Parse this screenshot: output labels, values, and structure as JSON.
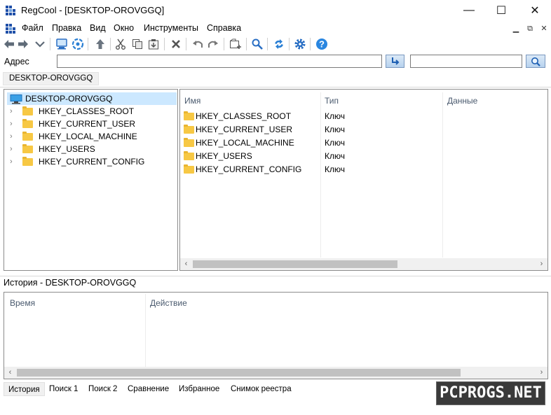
{
  "window": {
    "title": "RegCool - [DESKTOP-OROVGGQ]",
    "minimize": "—",
    "maximize": "☐",
    "close": "✕"
  },
  "menu": {
    "items": [
      "Файл",
      "Правка",
      "Вид",
      "Окно",
      "Инструменты",
      "Справка"
    ]
  },
  "toolbar": {
    "icons": [
      "back-icon",
      "forward-icon",
      "dropdown-icon",
      "computer-icon",
      "network-icon",
      "up-icon",
      "cut-icon",
      "copy-icon",
      "paste-icon",
      "delete-icon",
      "undo-icon",
      "redo-icon",
      "new-key-icon",
      "search-icon",
      "refresh-icon",
      "settings-icon",
      "help-icon"
    ]
  },
  "address": {
    "label": "Адрес",
    "value": "",
    "search_value": ""
  },
  "breadcrumb": {
    "tab": "DESKTOP-OROVGGQ"
  },
  "tree": {
    "root": "DESKTOP-OROVGGQ",
    "nodes": [
      "HKEY_CLASSES_ROOT",
      "HKEY_CURRENT_USER",
      "HKEY_LOCAL_MACHINE",
      "HKEY_USERS",
      "HKEY_CURRENT_CONFIG"
    ]
  },
  "list": {
    "columns": [
      "Имя",
      "Тип",
      "Данные"
    ],
    "rows": [
      {
        "name": "HKEY_CLASSES_ROOT",
        "type": "Ключ"
      },
      {
        "name": "HKEY_CURRENT_USER",
        "type": "Ключ"
      },
      {
        "name": "HKEY_LOCAL_MACHINE",
        "type": "Ключ"
      },
      {
        "name": "HKEY_USERS",
        "type": "Ключ"
      },
      {
        "name": "HKEY_CURRENT_CONFIG",
        "type": "Ключ"
      }
    ]
  },
  "history": {
    "title": "История - DESKTOP-OROVGGQ",
    "columns": [
      "Время",
      "Действие"
    ]
  },
  "bottom_tabs": [
    "История",
    "Поиск 1",
    "Поиск 2",
    "Сравнение",
    "Избранное",
    "Снимок реестра"
  ],
  "watermark": "PCPROGS.NET",
  "colors": {
    "accent": "#1f4fa8",
    "selection": "#cce8ff",
    "folder": "#f7c844"
  }
}
